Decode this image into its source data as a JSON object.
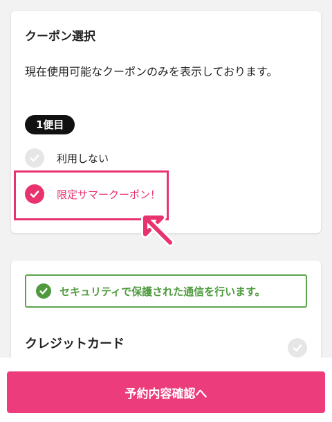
{
  "coupon": {
    "title": "クーポン選択",
    "description": "現在使用可能なクーポンのみを表示しております。",
    "flight_badge": "1便目",
    "options": [
      {
        "label": "利用しない",
        "selected": false,
        "icon": "check-icon"
      },
      {
        "label": "限定サマークーポン！",
        "selected": true,
        "icon": "check-icon"
      }
    ]
  },
  "security": {
    "message": "セキュリティで保護された通信を行います。",
    "icon": "check-icon"
  },
  "payment": {
    "title": "クレジットカード",
    "selected": false
  },
  "action": {
    "confirm_label": "予約内容確認へ"
  },
  "colors": {
    "accent": "#e8336e",
    "button": "#ec3c7c",
    "secure_green": "#4e9a3d",
    "badge_bg": "#111111",
    "unselected": "#e6e6e6"
  }
}
